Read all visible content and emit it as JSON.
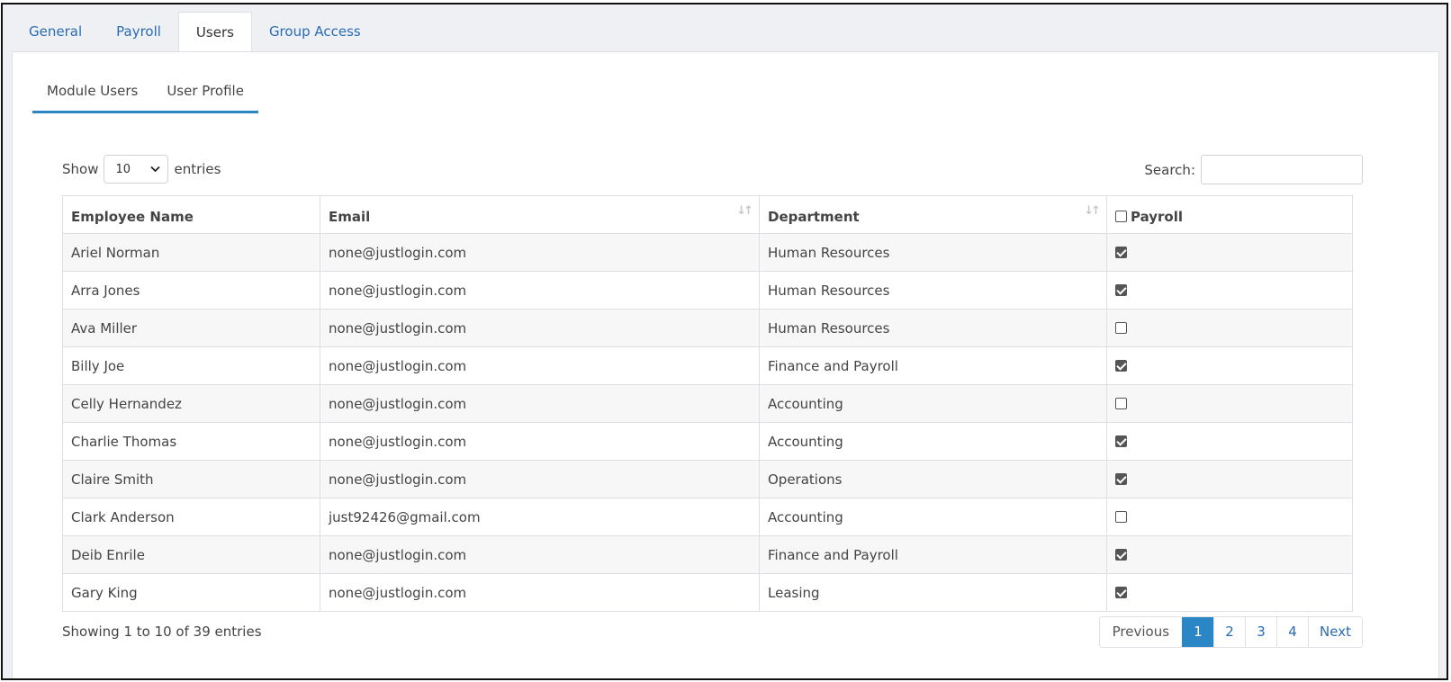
{
  "top_tabs": [
    {
      "label": "General",
      "active": false
    },
    {
      "label": "Payroll",
      "active": false
    },
    {
      "label": "Users",
      "active": true
    },
    {
      "label": "Group Access",
      "active": false
    }
  ],
  "sub_tabs": [
    {
      "label": "Module Users"
    },
    {
      "label": "User Profile"
    }
  ],
  "length_control": {
    "show_label": "Show",
    "selected": "10",
    "entries_label": "entries"
  },
  "search": {
    "label": "Search:",
    "value": ""
  },
  "table": {
    "columns": [
      "Employee Name",
      "Email",
      "Department",
      "Payroll"
    ],
    "rows": [
      {
        "name": "Ariel Norman",
        "email": "none@justlogin.com",
        "department": "Human Resources",
        "payroll": true
      },
      {
        "name": "Arra Jones",
        "email": "none@justlogin.com",
        "department": "Human Resources",
        "payroll": true
      },
      {
        "name": "Ava Miller",
        "email": "none@justlogin.com",
        "department": "Human Resources",
        "payroll": false
      },
      {
        "name": "Billy Joe",
        "email": "none@justlogin.com",
        "department": "Finance and Payroll",
        "payroll": true
      },
      {
        "name": "Celly Hernandez",
        "email": "none@justlogin.com",
        "department": "Accounting",
        "payroll": false
      },
      {
        "name": "Charlie Thomas",
        "email": "none@justlogin.com",
        "department": "Accounting",
        "payroll": true
      },
      {
        "name": "Claire Smith",
        "email": "none@justlogin.com",
        "department": "Operations",
        "payroll": true
      },
      {
        "name": "Clark Anderson",
        "email": "just92426@gmail.com",
        "department": "Accounting",
        "payroll": false
      },
      {
        "name": "Deib Enrile",
        "email": "none@justlogin.com",
        "department": "Finance and Payroll",
        "payroll": true
      },
      {
        "name": "Gary King",
        "email": "none@justlogin.com",
        "department": "Leasing",
        "payroll": true
      }
    ]
  },
  "info_text": "Showing 1 to 10 of 39 entries",
  "pagination": {
    "previous": "Previous",
    "pages": [
      "1",
      "2",
      "3",
      "4"
    ],
    "active_page": "1",
    "next": "Next"
  },
  "colors": {
    "accent": "#2b86c6",
    "link": "#2a6cb3"
  },
  "icons": {
    "sort": "sort-arrows-icon",
    "select": "chevron-down-icon",
    "checkbox": "checkbox-icon"
  }
}
